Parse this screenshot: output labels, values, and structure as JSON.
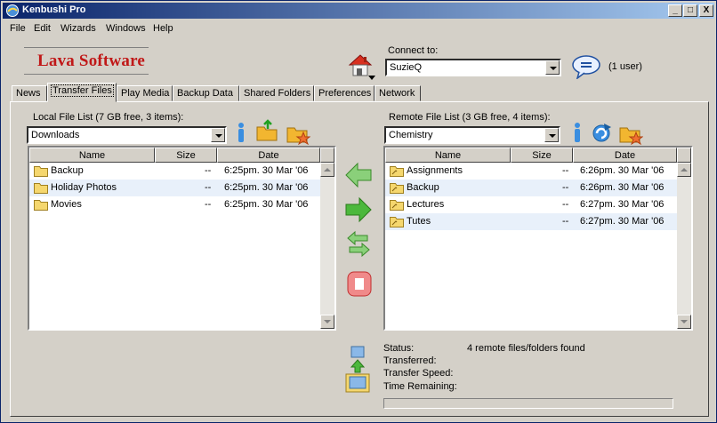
{
  "window": {
    "title": "Kenbushi Pro",
    "min_label": "_",
    "max_label": "□",
    "close_label": "X"
  },
  "menu": [
    "File",
    "Edit",
    "Wizards",
    "Windows",
    "Help"
  ],
  "logo": {
    "text": "Lava Software"
  },
  "connect": {
    "label": "Connect to:",
    "selected": "SuzieQ",
    "users": "(1 user)"
  },
  "tabs": [
    "News",
    "Transfer Files",
    "Play Media",
    "Backup Data",
    "Shared Folders",
    "Preferences",
    "Network"
  ],
  "active_tab": "Transfer Files",
  "local": {
    "title": "Local File List (7 GB free, 3 items):",
    "folder": "Downloads",
    "columns": [
      "Name",
      "Size",
      "Date"
    ],
    "rows": [
      {
        "name": "Backup",
        "size": "--",
        "date": "6:25pm. 30 Mar '06"
      },
      {
        "name": "Holiday Photos",
        "size": "--",
        "date": "6:25pm. 30 Mar '06"
      },
      {
        "name": "Movies",
        "size": "--",
        "date": "6:25pm. 30 Mar '06"
      }
    ]
  },
  "remote": {
    "title": "Remote File List (3 GB free, 4 items):",
    "folder": "Chemistry",
    "columns": [
      "Name",
      "Size",
      "Date"
    ],
    "rows": [
      {
        "name": "Assignments",
        "size": "--",
        "date": "6:26pm. 30 Mar '06"
      },
      {
        "name": "Backup",
        "size": "--",
        "date": "6:26pm. 30 Mar '06"
      },
      {
        "name": "Lectures",
        "size": "--",
        "date": "6:27pm. 30 Mar '06"
      },
      {
        "name": "Tutes",
        "size": "--",
        "date": "6:27pm. 30 Mar '06"
      }
    ]
  },
  "status": {
    "status_label": "Status:",
    "status_value": "4 remote files/folders found",
    "transferred_label": "Transferred:",
    "speed_label": "Transfer Speed:",
    "remaining_label": "Time Remaining:",
    "progress": 0
  },
  "colors": {
    "title_start": "#0a246a",
    "title_end": "#a6caf0",
    "logo": "#c01818",
    "row_alt": "#e8f0fa"
  }
}
